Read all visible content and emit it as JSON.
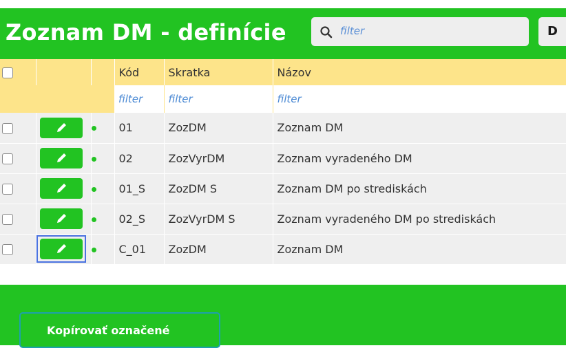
{
  "header": {
    "title": "Zoznam DM - definície",
    "search_placeholder": "filter",
    "right_button_label": "D"
  },
  "columns": {
    "kod": "Kód",
    "skratka": "Skratka",
    "nazov": "Názov"
  },
  "filters": {
    "kod": "filter",
    "skratka": "filter",
    "nazov": "filter"
  },
  "rows": [
    {
      "kod": "01",
      "skratka": "ZozDM",
      "nazov": "Zoznam DM"
    },
    {
      "kod": "02",
      "skratka": "ZozVyrDM",
      "nazov": "Zoznam vyradeného DM"
    },
    {
      "kod": "01_S",
      "skratka": "ZozDM S",
      "nazov": "Zoznam DM po strediskách"
    },
    {
      "kod": "02_S",
      "skratka": "ZozVyrDM S",
      "nazov": "Zoznam vyradeného DM po strediskách"
    },
    {
      "kod": "C_01",
      "skratka": "ZozDM",
      "nazov": "Zoznam DM"
    }
  ],
  "footer": {
    "copy_label": "Kopírovať označené"
  },
  "icons": {
    "search": "search-icon",
    "edit": "pencil-icon",
    "status": "active-dot-icon"
  },
  "colors": {
    "brand_green": "#22c322",
    "header_yellow": "#fde48a",
    "filter_text": "#4c8ad4",
    "focus_outline": "#4a72e0"
  }
}
